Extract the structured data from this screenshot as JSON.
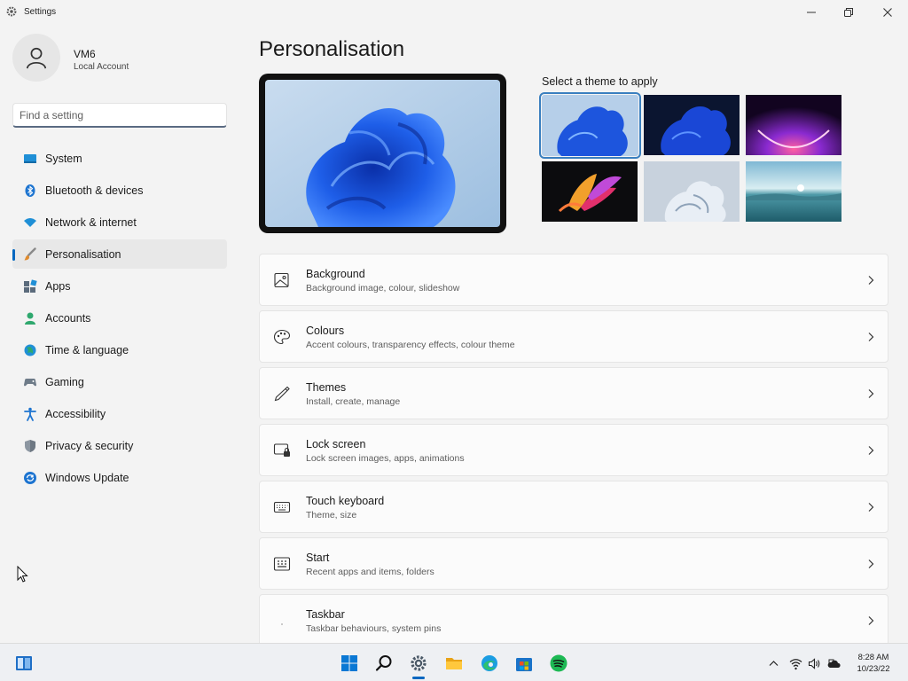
{
  "window": {
    "title": "Settings"
  },
  "profile": {
    "name": "VM6",
    "account_type": "Local Account"
  },
  "search": {
    "placeholder": "Find a setting"
  },
  "nav": {
    "items": [
      {
        "label": "System",
        "icon": "system-icon"
      },
      {
        "label": "Bluetooth & devices",
        "icon": "bluetooth-icon"
      },
      {
        "label": "Network & internet",
        "icon": "wifi-icon"
      },
      {
        "label": "Personalisation",
        "icon": "brush-icon",
        "active": true
      },
      {
        "label": "Apps",
        "icon": "apps-icon"
      },
      {
        "label": "Accounts",
        "icon": "accounts-icon"
      },
      {
        "label": "Time & language",
        "icon": "globe-icon"
      },
      {
        "label": "Gaming",
        "icon": "gamepad-icon"
      },
      {
        "label": "Accessibility",
        "icon": "accessibility-icon"
      },
      {
        "label": "Privacy & security",
        "icon": "shield-icon"
      },
      {
        "label": "Windows Update",
        "icon": "update-icon"
      }
    ]
  },
  "page": {
    "title": "Personalisation",
    "theme_caption": "Select a theme to apply"
  },
  "themes": [
    {
      "name": "windows-light-bloom",
      "selected": true
    },
    {
      "name": "windows-dark-bloom"
    },
    {
      "name": "glow"
    },
    {
      "name": "captured-motion"
    },
    {
      "name": "sunrise"
    },
    {
      "name": "flow"
    }
  ],
  "cards": [
    {
      "title": "Background",
      "subtitle": "Background image, colour, slideshow",
      "icon": "image-icon"
    },
    {
      "title": "Colours",
      "subtitle": "Accent colours, transparency effects, colour theme",
      "icon": "palette-icon"
    },
    {
      "title": "Themes",
      "subtitle": "Install, create, manage",
      "icon": "pen-icon"
    },
    {
      "title": "Lock screen",
      "subtitle": "Lock screen images, apps, animations",
      "icon": "lock-screen-icon"
    },
    {
      "title": "Touch keyboard",
      "subtitle": "Theme, size",
      "icon": "keyboard-icon"
    },
    {
      "title": "Start",
      "subtitle": "Recent apps and items, folders",
      "icon": "start-icon"
    },
    {
      "title": "Taskbar",
      "subtitle": "Taskbar behaviours, system pins",
      "icon": "taskbar-icon"
    }
  ],
  "taskbar": {
    "apps": [
      "widgets-icon",
      "start-icon",
      "search-icon",
      "settings-icon",
      "file-explorer-icon",
      "edge-icon",
      "store-icon",
      "spotify-icon"
    ],
    "tray": [
      "chevron-up-icon",
      "wifi-icon",
      "volume-icon",
      "cloud-icon"
    ],
    "time": "8:28 AM",
    "date": "10/23/22"
  },
  "colors": {
    "accent": "#0067c0",
    "background": "#f3f3f3",
    "card": "#fbfbfb"
  }
}
